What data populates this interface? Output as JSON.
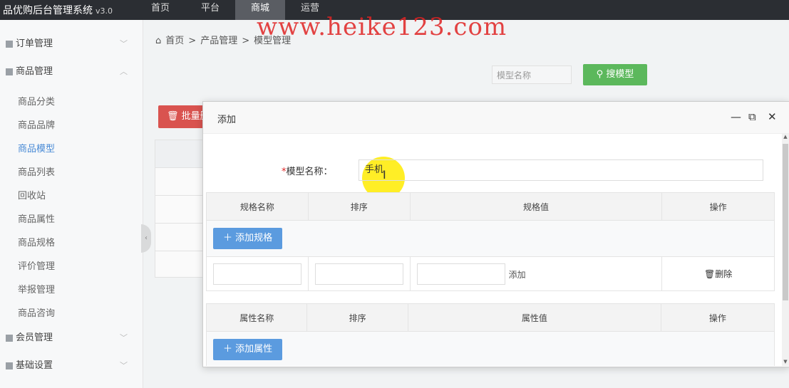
{
  "app": {
    "title": "品优购后台管理系统",
    "version": "v3.0"
  },
  "topnav": [
    "首页",
    "平台",
    "商城",
    "运营"
  ],
  "watermark": "www.heike123.com",
  "sidebar": {
    "groups": [
      {
        "label": "订单管理",
        "chevron": "﹀"
      },
      {
        "label": "商品管理",
        "chevron": "︿"
      },
      {
        "label": "会员管理",
        "chevron": "﹀"
      },
      {
        "label": "基础设置",
        "chevron": "﹀"
      }
    ],
    "items": [
      "商品分类",
      "商品品牌",
      "商品模型",
      "商品列表",
      "回收站",
      "商品属性",
      "商品规格",
      "评价管理",
      "举报管理",
      "商品咨询"
    ]
  },
  "breadcrumb": {
    "home": "首页",
    "sep": ">",
    "level1": "产品管理",
    "level2": "模型管理"
  },
  "search": {
    "placeholder": "模型名称",
    "button": "搜模型"
  },
  "batch_button": "批量删除",
  "dialog": {
    "title": "添加",
    "name_label": "模型名称：",
    "name_required": "*",
    "name_value": "手机",
    "spec_table": {
      "headers": [
        "规格名称",
        "排序",
        "规格值",
        "操作"
      ],
      "add_button": "添加规格",
      "add_value_link": "添加",
      "delete": "删除"
    },
    "attr_table": {
      "headers": [
        "属性名称",
        "排序",
        "属性值",
        "操作"
      ],
      "add_button": "添加属性"
    }
  }
}
